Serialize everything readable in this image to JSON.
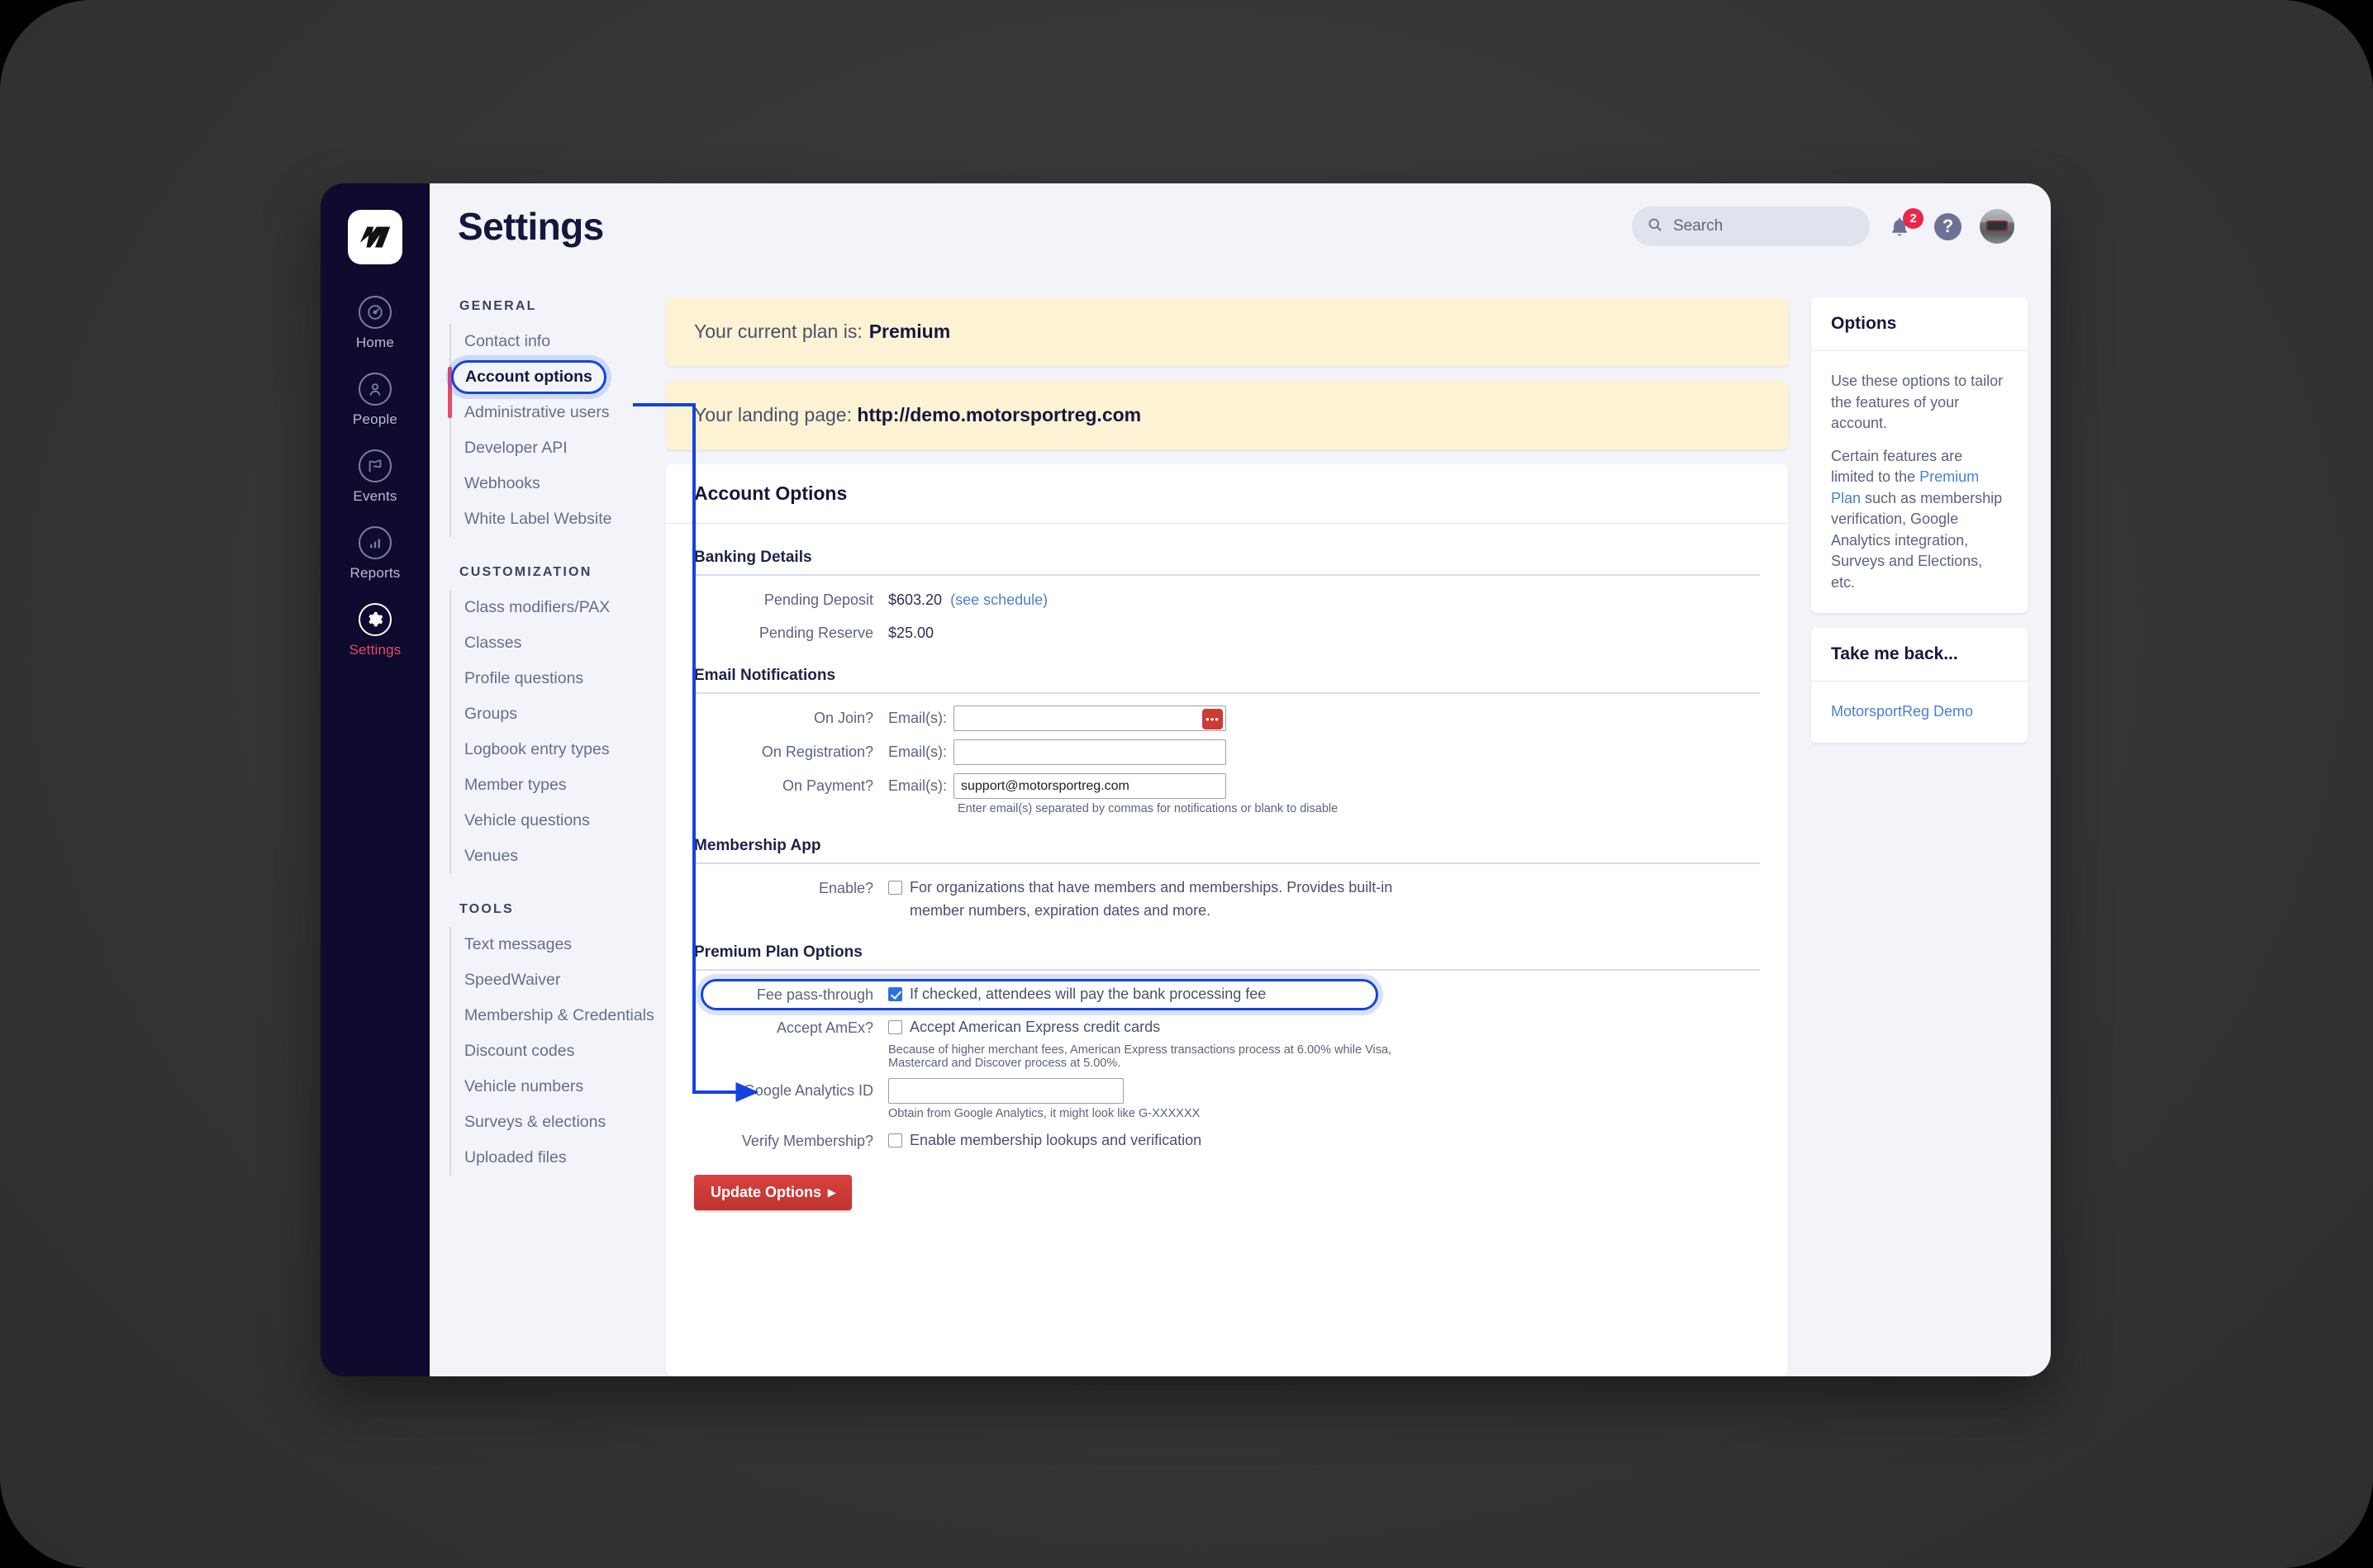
{
  "app": {
    "logo_icon": "motorsportreg-m-logo",
    "rail": [
      {
        "label": "Home",
        "icon": "gauge-icon",
        "active": false
      },
      {
        "label": "People",
        "icon": "person-icon",
        "active": false
      },
      {
        "label": "Events",
        "icon": "flag-icon",
        "active": false
      },
      {
        "label": "Reports",
        "icon": "bar-chart-icon",
        "active": false
      },
      {
        "label": "Settings",
        "icon": "gear-icon",
        "active": true
      }
    ]
  },
  "header": {
    "title": "Settings",
    "search_placeholder": "Search",
    "search_value": "",
    "notification_count": "2",
    "help_label": "?"
  },
  "settings_nav": {
    "groups": [
      {
        "title": "GENERAL",
        "items": [
          {
            "label": "Contact info",
            "active": false
          },
          {
            "label": "Account options",
            "active": true
          },
          {
            "label": "Administrative users",
            "active": false
          },
          {
            "label": "Developer API",
            "active": false
          },
          {
            "label": "Webhooks",
            "active": false
          },
          {
            "label": "White Label Website",
            "active": false
          }
        ]
      },
      {
        "title": "CUSTOMIZATION",
        "items": [
          {
            "label": "Class modifiers/PAX",
            "active": false
          },
          {
            "label": "Classes",
            "active": false
          },
          {
            "label": "Profile questions",
            "active": false
          },
          {
            "label": "Groups",
            "active": false
          },
          {
            "label": "Logbook entry types",
            "active": false
          },
          {
            "label": "Member types",
            "active": false
          },
          {
            "label": "Vehicle questions",
            "active": false
          },
          {
            "label": "Venues",
            "active": false
          }
        ]
      },
      {
        "title": "TOOLS",
        "items": [
          {
            "label": "Text messages",
            "active": false
          },
          {
            "label": "SpeedWaiver",
            "active": false
          },
          {
            "label": "Membership & Credentials",
            "active": false
          },
          {
            "label": "Discount codes",
            "active": false
          },
          {
            "label": "Vehicle numbers",
            "active": false
          },
          {
            "label": "Surveys & elections",
            "active": false
          },
          {
            "label": "Uploaded files",
            "active": false
          }
        ]
      }
    ]
  },
  "banners": {
    "plan_label": "Your current plan is:",
    "plan_value": "Premium",
    "landing_label": "Your landing page:",
    "landing_value": "http://demo.motorsportreg.com"
  },
  "main": {
    "card_title": "Account Options",
    "banking": {
      "title": "Banking Details",
      "pending_deposit_label": "Pending Deposit",
      "pending_deposit_value": "$603.20",
      "see_schedule_link": "(see schedule)",
      "pending_reserve_label": "Pending Reserve",
      "pending_reserve_value": "$25.00"
    },
    "email": {
      "title": "Email Notifications",
      "emails_sublabel": "Email(s):",
      "on_join_label": "On Join?",
      "on_join_value": "",
      "on_join_icon": "password-manager-icon",
      "on_registration_label": "On Registration?",
      "on_registration_value": "",
      "on_payment_label": "On Payment?",
      "on_payment_value": "support@motorsportreg.com",
      "helper": "Enter email(s) separated by commas for notifications or blank to disable"
    },
    "membership_app": {
      "title": "Membership App",
      "enable_label": "Enable?",
      "enable_checked": false,
      "enable_text": "For organizations that have members and memberships. Provides built-in member numbers, expiration dates and more."
    },
    "premium": {
      "title": "Premium Plan Options",
      "fee_label": "Fee pass-through",
      "fee_checked": true,
      "fee_text": "If checked, attendees will pay the bank processing fee",
      "amex_label": "Accept AmEx?",
      "amex_checked": false,
      "amex_text": "Accept American Express credit cards",
      "amex_helper": "Because of higher merchant fees, American Express transactions process at 6.00% while Visa, Mastercard and Discover process at 5.00%.",
      "ga_label": "Google Analytics ID",
      "ga_value": "",
      "ga_helper": "Obtain from Google Analytics, it might look like G-XXXXXX",
      "verify_label": "Verify Membership?",
      "verify_checked": false,
      "verify_text": "Enable membership lookups and verification"
    },
    "submit_label": "Update Options"
  },
  "aside": {
    "options_title": "Options",
    "options_p1": "Use these options to tailor the features of your account.",
    "options_p2_a": "Certain features are limited to the ",
    "options_p2_link": "Premium Plan",
    "options_p2_b": " such as membership verification, Google Analytics integration, Surveys and Elections, etc.",
    "back_title": "Take me back...",
    "back_link": "MotorsportReg Demo"
  },
  "annotation": {
    "accent": "#1442e0"
  }
}
